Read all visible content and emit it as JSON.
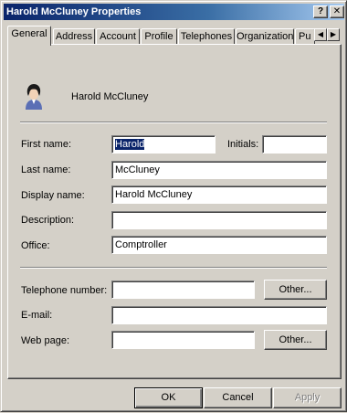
{
  "window": {
    "title": "Harold McCluney Properties",
    "help_label": "?",
    "close_label": "✕"
  },
  "tabs": [
    {
      "label": "General",
      "active": true
    },
    {
      "label": "Address"
    },
    {
      "label": "Account"
    },
    {
      "label": "Profile"
    },
    {
      "label": "Telephones"
    },
    {
      "label": "Organization"
    },
    {
      "label": "Pu"
    }
  ],
  "tab_scroll": {
    "left": "◀",
    "right": "▶"
  },
  "header": {
    "name": "Harold McCluney",
    "avatar_icon": "user-icon"
  },
  "form": {
    "first_name_label": "First name:",
    "first_name_value": "Harold",
    "initials_label": "Initials:",
    "initials_value": "",
    "last_name_label": "Last name:",
    "last_name_value": "McCluney",
    "display_name_label": "Display name:",
    "display_name_value": "Harold McCluney",
    "description_label": "Description:",
    "description_value": "",
    "office_label": "Office:",
    "office_value": "Comptroller",
    "telephone_label": "Telephone number:",
    "telephone_value": "",
    "telephone_other": "Other...",
    "email_label": "E-mail:",
    "email_value": "",
    "webpage_label": "Web page:",
    "webpage_value": "",
    "webpage_other": "Other..."
  },
  "footer": {
    "ok": "OK",
    "cancel": "Cancel",
    "apply": "Apply"
  }
}
